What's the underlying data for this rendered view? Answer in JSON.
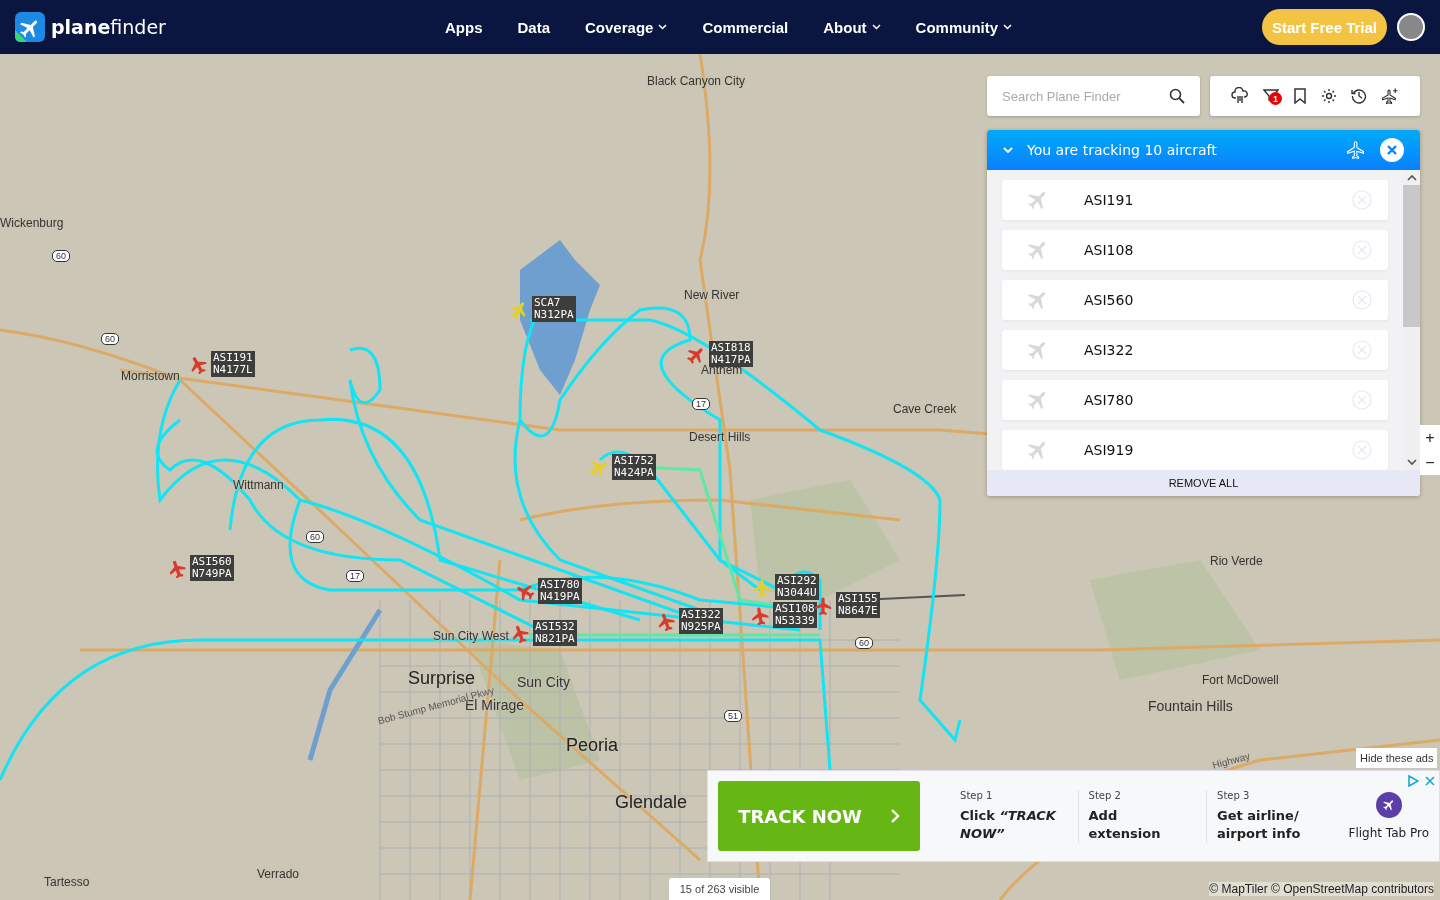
{
  "header": {
    "logo": "**plane**finder",
    "nav": [
      {
        "label": "Apps",
        "dropdown": false
      },
      {
        "label": "Data",
        "dropdown": false
      },
      {
        "label": "Coverage",
        "dropdown": true
      },
      {
        "label": "Commercial",
        "dropdown": false
      },
      {
        "label": "About",
        "dropdown": true
      },
      {
        "label": "Community",
        "dropdown": true
      }
    ],
    "cta": "Start Free Trial"
  },
  "map": {
    "places": [
      {
        "name": "Black Canyon City",
        "kind": "town"
      },
      {
        "name": "Wickenburg",
        "kind": "town"
      },
      {
        "name": "Morristown",
        "kind": "town"
      },
      {
        "name": "New River",
        "kind": "town"
      },
      {
        "name": "Anthem",
        "kind": "town"
      },
      {
        "name": "Cave Creek",
        "kind": "town"
      },
      {
        "name": "Desert Hills",
        "kind": "town"
      },
      {
        "name": "Wittmann",
        "kind": "town"
      },
      {
        "name": "Rio Verde",
        "kind": "town"
      },
      {
        "name": "Sun City West",
        "kind": "town"
      },
      {
        "name": "Surprise",
        "kind": "city"
      },
      {
        "name": "Sun City",
        "kind": "suburb"
      },
      {
        "name": "El Mirage",
        "kind": "suburb"
      },
      {
        "name": "Peoria",
        "kind": "city"
      },
      {
        "name": "Glendale",
        "kind": "city"
      },
      {
        "name": "Fort McDowell",
        "kind": "town"
      },
      {
        "name": "Fountain Hills",
        "kind": "suburb"
      },
      {
        "name": "Tartesso",
        "kind": "town"
      },
      {
        "name": "Verrado",
        "kind": "town"
      },
      {
        "name": "Bob Stump Memorial Pkwy",
        "kind": "road"
      },
      {
        "name": "Highway",
        "kind": "road"
      }
    ],
    "shields": [
      "60",
      "60",
      "60",
      "17",
      "17",
      "51",
      "60"
    ],
    "aircraft": [
      {
        "callsign": "SCA7",
        "registration": "N312PA",
        "color": "#e8d020"
      },
      {
        "callsign": "ASI191",
        "registration": "N4177L",
        "color": "#d83a2c"
      },
      {
        "callsign": "ASI818",
        "registration": "N417PA",
        "color": "#d83a2c"
      },
      {
        "callsign": "ASI752",
        "registration": "N424PA",
        "color": "#e8d020"
      },
      {
        "callsign": "ASI560",
        "registration": "N749PA",
        "color": "#d83a2c"
      },
      {
        "callsign": "ASI780",
        "registration": "N419PA",
        "color": "#d83a2c"
      },
      {
        "callsign": "ASI532",
        "registration": "N821PA",
        "color": "#d83a2c"
      },
      {
        "callsign": "ASI322",
        "registration": "N925PA",
        "color": "#d83a2c"
      },
      {
        "callsign": "ASI292",
        "registration": "N3044U",
        "color": "#e8d020"
      },
      {
        "callsign": "ASI108",
        "registration": "N53339",
        "color": "#d83a2c"
      },
      {
        "callsign": "ASI155",
        "registration": "N8647E",
        "color": "#d83a2c"
      }
    ],
    "zoom_in": "+",
    "zoom_out": "−",
    "visible_count": "15 of 263 visible",
    "attribution": "© MapTiler © OpenStreetMap contributors"
  },
  "search": {
    "placeholder": "Search Plane Finder"
  },
  "toolbar": {
    "filter_badge": "1"
  },
  "tracking": {
    "title": "You are tracking 10 aircraft",
    "expanded": true,
    "items": [
      "ASI191",
      "ASI108",
      "ASI560",
      "ASI322",
      "ASI780",
      "ASI919"
    ],
    "remove_all": "REMOVE ALL"
  },
  "ad": {
    "hide": "Hide these ads",
    "button": "TRACK NOW",
    "steps": [
      {
        "step": "Step 1",
        "text": "Click *“TRACK NOW”*"
      },
      {
        "step": "Step 2",
        "text": "Add extension"
      },
      {
        "step": "Step 3",
        "text": "Get airline/ airport info"
      }
    ],
    "product": "Flight Tab Pro"
  }
}
